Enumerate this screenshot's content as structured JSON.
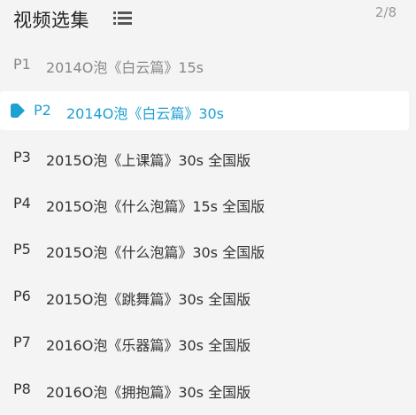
{
  "header": {
    "title": "视频选集",
    "list_icon": "list-icon",
    "counter": "2/8"
  },
  "colors": {
    "active": "#1da0d2",
    "text": "#333333",
    "muted": "#888888",
    "background": "#f4f4f4"
  },
  "episodes": [
    {
      "num": "P1",
      "title": "2014O泡《白云篇》15s",
      "state": "watched"
    },
    {
      "num": "P2",
      "title": "2014O泡《白云篇》30s",
      "state": "playing",
      "icon": "play-icon"
    },
    {
      "num": "P3",
      "title": "2015O泡《上课篇》30s 全国版",
      "state": "normal"
    },
    {
      "num": "P4",
      "title": "2015O泡《什么泡篇》15s 全国版",
      "state": "normal"
    },
    {
      "num": "P5",
      "title": "2015O泡《什么泡篇》30s 全国版",
      "state": "normal"
    },
    {
      "num": "P6",
      "title": "2015O泡《跳舞篇》30s 全国版",
      "state": "normal"
    },
    {
      "num": "P7",
      "title": "2016O泡《乐器篇》30s 全国版",
      "state": "normal"
    },
    {
      "num": "P8",
      "title": "2016O泡《拥抱篇》30s 全国版",
      "state": "normal"
    }
  ]
}
